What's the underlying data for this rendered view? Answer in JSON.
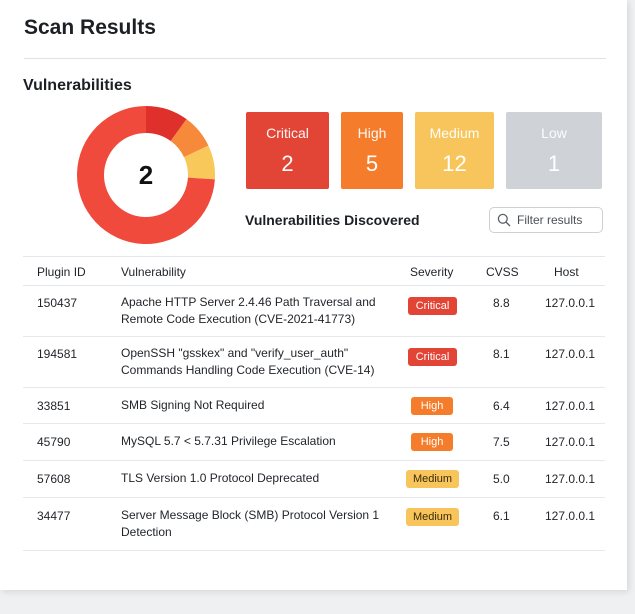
{
  "page_title": "Scan Results",
  "section_title": "Vulnerabilities",
  "donut": {
    "total": "2",
    "segments": [
      {
        "severity": "Critical",
        "share": 0.1,
        "color": "#e0302b"
      },
      {
        "severity": "High",
        "share": 0.08,
        "color": "#f6893a"
      },
      {
        "severity": "Medium",
        "share": 0.08,
        "color": "#f9c85a"
      },
      {
        "severity": "Critical",
        "share": 0.74,
        "color": "#f04a3d"
      }
    ]
  },
  "tiles": [
    {
      "label": "Critical",
      "count": "2",
      "color": "#e24436"
    },
    {
      "label": "High",
      "count": "5",
      "color": "#f57c2b"
    },
    {
      "label": "Medium",
      "count": "12",
      "color": "#f8c55c"
    },
    {
      "label": "Low",
      "count": "1",
      "color": "#cfd2d6"
    }
  ],
  "discovered_label": "Vulnerabilities Discovered",
  "filter": {
    "placeholder": "Filter results",
    "value": ""
  },
  "table": {
    "columns": {
      "plugin_id": "Plugin ID",
      "vulnerability": "Vulnerability",
      "severity": "Severity",
      "cvss": "CVSS",
      "host": "Host"
    },
    "rows": [
      {
        "plugin_id": "150437",
        "vulnerability": "Apache HTTP Server 2.4.46 Path Traversal and Remote Code Execution (CVE-2021-41773)",
        "severity": "Critical",
        "cvss": "8.8",
        "host": "127.0.0.1"
      },
      {
        "plugin_id": "194581",
        "vulnerability": "OpenSSH \"gsskex\" and \"verify_user_auth\" Commands Handling Code Execution (CVE-14)",
        "severity": "Critical",
        "cvss": "8.1",
        "host": "127.0.0.1"
      },
      {
        "plugin_id": "33851",
        "vulnerability": "SMB Signing Not Required",
        "severity": "High",
        "cvss": "6.4",
        "host": "127.0.0.1"
      },
      {
        "plugin_id": "45790",
        "vulnerability": "MySQL 5.7 < 5.7.31 Privilege Escalation",
        "severity": "High",
        "cvss": "7.5",
        "host": "127.0.0.1"
      },
      {
        "plugin_id": "57608",
        "vulnerability": "TLS Version 1.0 Protocol Deprecated",
        "severity": "Medium",
        "cvss": "5.0",
        "host": "127.0.0.1"
      },
      {
        "plugin_id": "34477",
        "vulnerability": "Server Message Block (SMB) Protocol Version 1 Detection",
        "severity": "Medium",
        "cvss": "6.1",
        "host": "127.0.0.1"
      }
    ]
  }
}
